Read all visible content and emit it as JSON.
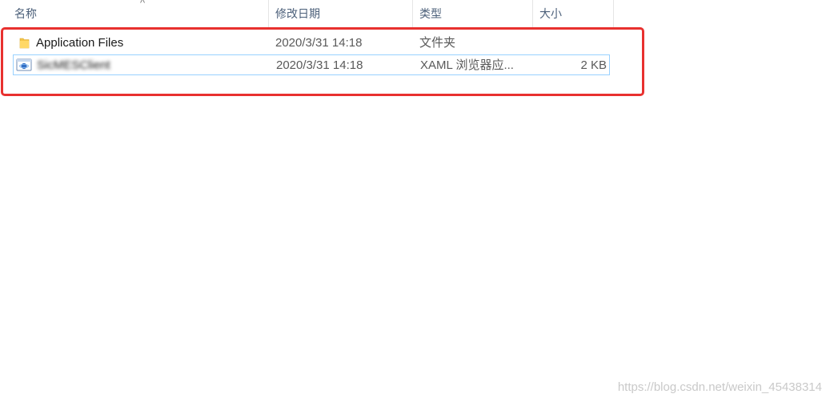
{
  "columns": {
    "name": "名称",
    "date": "修改日期",
    "type": "类型",
    "size": "大小"
  },
  "sort_indicator": "^",
  "files": [
    {
      "icon": "folder-icon",
      "name": "Application Files",
      "date": "2020/3/31 14:18",
      "type": "文件夹",
      "size": ""
    },
    {
      "icon": "xaml-browser-app-icon",
      "name": "SicMESClient",
      "date": "2020/3/31 14:18",
      "type": "XAML 浏览器应...",
      "size": "2 KB"
    }
  ],
  "watermark": "https://blog.csdn.net/weixin_45438314",
  "colors": {
    "highlight": "#e8312f",
    "selection_border": "#99d1ff",
    "header_text": "#4c607a",
    "folder": "#f5c54a"
  }
}
